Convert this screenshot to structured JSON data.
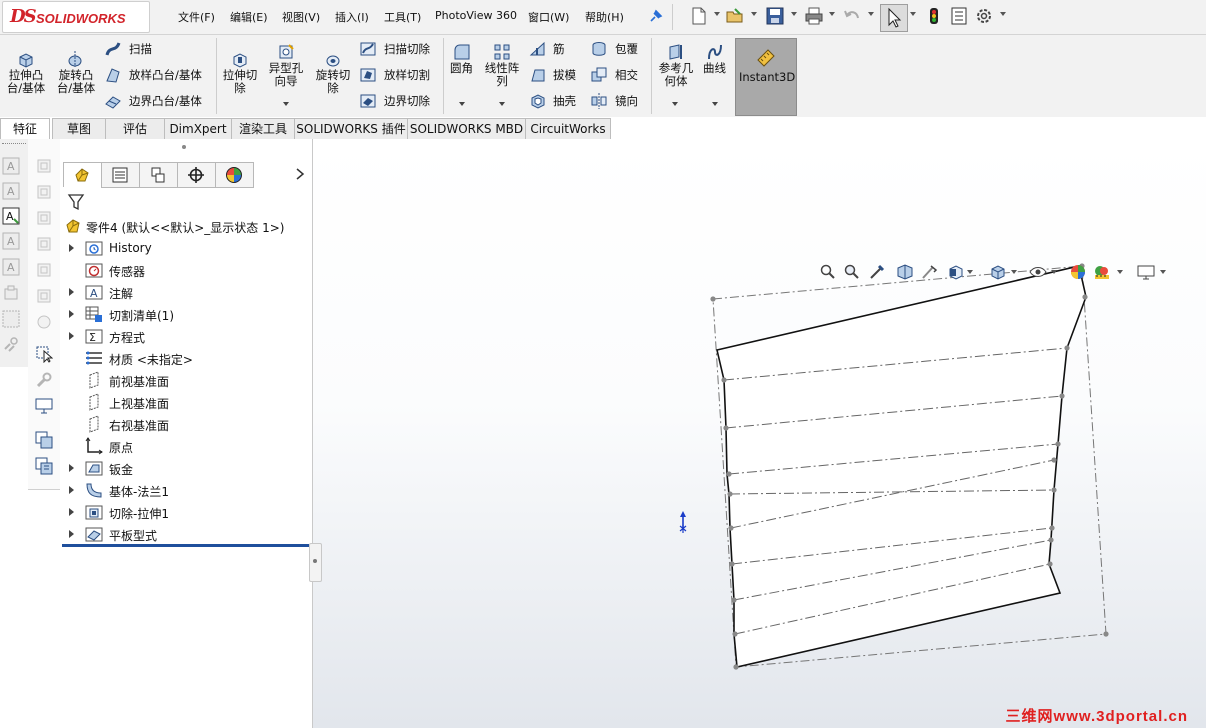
{
  "app": {
    "logo_ds": "DS",
    "logo_text": "SOLIDWORKS"
  },
  "menu": [
    "文件(F)",
    "编辑(E)",
    "视图(V)",
    "插入(I)",
    "工具(T)",
    "PhotoView 360",
    "窗口(W)",
    "帮助(H)"
  ],
  "commands": {
    "extrude_boss": "拉伸凸\n台/基体",
    "revolve_boss": "旋转凸\n台/基体",
    "sweep": "扫描",
    "loft_boss": "放样凸台/基体",
    "boundary_boss": "边界凸台/基体",
    "extrude_cut": "拉伸切\n除",
    "hole_wizard": "异型孔\n向导",
    "revolve_cut": "旋转切\n除",
    "swept_cut": "扫描切除",
    "lofted_cut": "放样切割",
    "boundary_cut": "边界切除",
    "fillet": "圆角",
    "linear_pattern": "线性阵\n列",
    "rib": "筋",
    "draft": "拔模",
    "shell": "抽壳",
    "wrap": "包覆",
    "intersect": "相交",
    "mirror": "镜向",
    "ref_geometry": "参考几\n何体",
    "curves": "曲线",
    "instant3d": "Instant3D"
  },
  "tabs": [
    "特征",
    "草图",
    "评估",
    "DimXpert",
    "渲染工具",
    "SOLIDWORKS 插件",
    "SOLIDWORKS MBD",
    "CircuitWorks"
  ],
  "tree": {
    "root": "零件4  (默认<<默认>_显示状态 1>)",
    "items": [
      {
        "label": "History",
        "expand": true
      },
      {
        "label": "传感器",
        "expand": false
      },
      {
        "label": "注解",
        "expand": true
      },
      {
        "label": "切割清单(1)",
        "expand": true
      },
      {
        "label": "方程式",
        "expand": true
      },
      {
        "label": "材质 <未指定>",
        "expand": false
      },
      {
        "label": "前视基准面",
        "expand": false
      },
      {
        "label": "上视基准面",
        "expand": false
      },
      {
        "label": "右视基准面",
        "expand": false
      },
      {
        "label": "原点",
        "expand": false
      },
      {
        "label": "钣金",
        "expand": true
      },
      {
        "label": "基体-法兰1",
        "expand": true
      },
      {
        "label": "切除-拉伸1",
        "expand": true
      },
      {
        "label": "平板型式",
        "expand": true
      }
    ]
  },
  "watermark": "三维网www.3dportal.cn",
  "colors": {
    "accent_red": "#d2232a",
    "tree_blue": "#1f4f9c",
    "instant3d_bg": "#a9a9a9"
  }
}
